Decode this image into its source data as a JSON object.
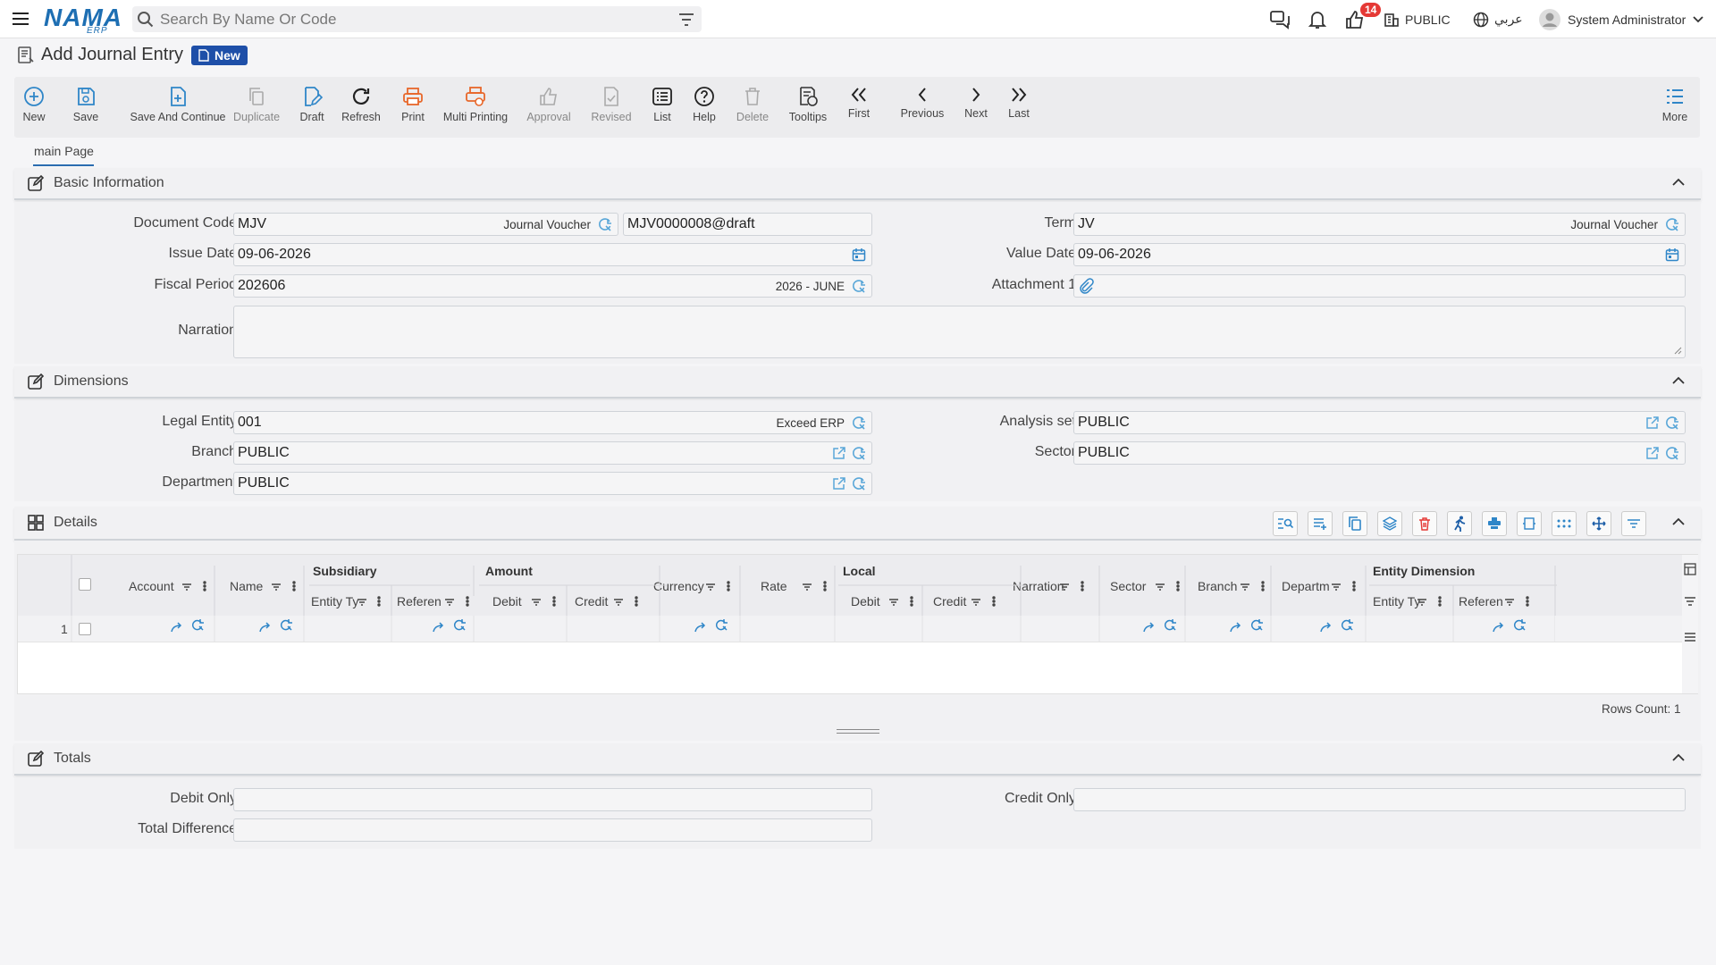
{
  "app": {
    "logo": "NAMA",
    "logo_sub": "ERP"
  },
  "search": {
    "placeholder": "Search By Name Or Code"
  },
  "topbar": {
    "notif_count": "14",
    "company": "PUBLIC",
    "language": "عربي",
    "user": "System Administrator"
  },
  "page": {
    "title": "Add Journal Entry",
    "mode_badge": "New"
  },
  "toolbar": {
    "new": "New",
    "save": "Save",
    "save_continue": "Save And Continue",
    "duplicate": "Duplicate",
    "draft": "Draft",
    "refresh": "Refresh",
    "print": "Print",
    "multi_printing": "Multi Printing",
    "approval": "Approval",
    "revised": "Revised",
    "list": "List",
    "help": "Help",
    "delete": "Delete",
    "tooltips": "Tooltips",
    "first": "First",
    "previous": "Previous",
    "next": "Next",
    "last": "Last",
    "more": "More"
  },
  "tabs": {
    "main": "main Page"
  },
  "basic": {
    "title": "Basic Information",
    "document_code_label": "Document Code",
    "document_code": "MJV",
    "document_code_tag": "Journal Voucher",
    "document_number": "MJV0000008@draft",
    "term_label": "Term",
    "term": "JV",
    "term_tag": "Journal Voucher",
    "issue_date_label": "Issue Date",
    "issue_date": "09-06-2026",
    "value_date_label": "Value Date",
    "value_date": "09-06-2026",
    "fiscal_period_label": "Fiscal Period",
    "fiscal_period": "202606",
    "fiscal_period_tag": "2026 - JUNE",
    "attachment_label": "Attachment 1",
    "narration_label": "Narration"
  },
  "dimensions": {
    "title": "Dimensions",
    "legal_entity_label": "Legal Entity",
    "legal_entity": "001",
    "legal_entity_tag": "Exceed ERP",
    "analysis_set_label": "Analysis set",
    "analysis_set": "PUBLIC",
    "branch_label": "Branch",
    "branch": "PUBLIC",
    "sector_label": "Sector",
    "sector": "PUBLIC",
    "department_label": "Department",
    "department": "PUBLIC"
  },
  "details": {
    "title": "Details",
    "group_subsidiary": "Subsidiary",
    "group_amount": "Amount",
    "group_local": "Local",
    "group_entity_dimension": "Entity Dimension",
    "col_account": "Account",
    "col_name": "Name",
    "col_entity_type": "Entity T​y",
    "col_reference": "Referen",
    "col_debit": "Debit",
    "col_credit": "Credit",
    "col_currency": "Currency",
    "col_rate": "Rate",
    "col_local_debit": "Debit",
    "col_local_credit": "Credit",
    "col_narration": "Narration",
    "col_sector": "Sector",
    "col_branch": "Branch",
    "col_department": "Departm",
    "col_ed_entity_type": "Entity T​y",
    "col_ed_reference": "Referen",
    "row_number": "1",
    "rows_count": "Rows Count: 1"
  },
  "totals": {
    "title": "Totals",
    "debit_only_label": "Debit Only",
    "credit_only_label": "Credit Only",
    "total_difference_label": "Total Difference"
  }
}
